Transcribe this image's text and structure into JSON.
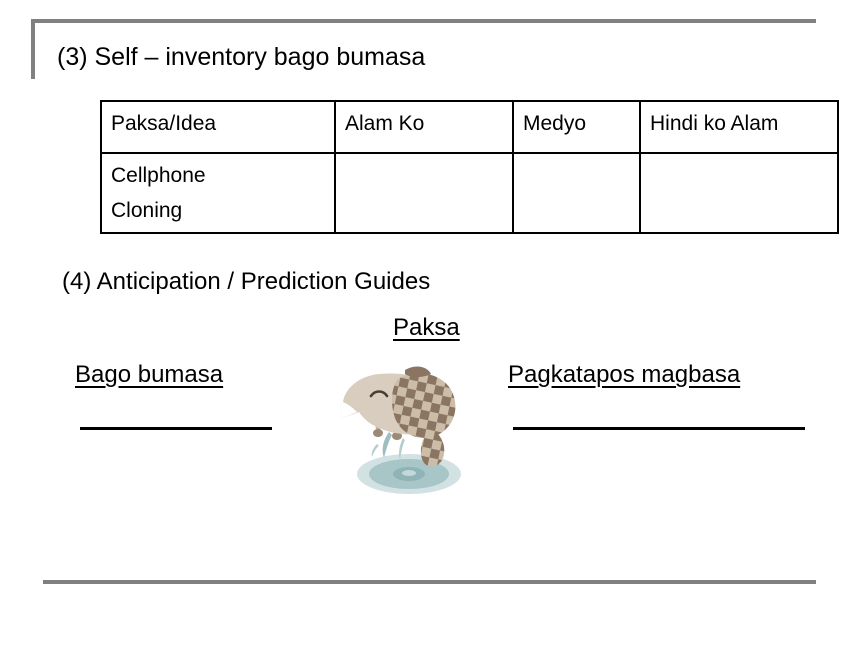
{
  "slide": {
    "section3": {
      "heading": "(3) Self – inventory bago bumasa",
      "table": {
        "headers": [
          "Paksa/Idea",
          "Alam Ko",
          "Medyo",
          "Hindi ko Alam"
        ],
        "rows": [
          {
            "topic_line1": "Cellphone",
            "topic_line2": "Cloning",
            "alam_ko": "",
            "medyo": "",
            "hindi_ko_alam": ""
          }
        ]
      }
    },
    "section4": {
      "heading": "(4) Anticipation / Prediction Guides",
      "topic_label": "Paksa",
      "before_label": "Bago bumasa",
      "after_label": "Pagkatapos magbasa",
      "before_answer": "",
      "after_answer": ""
    },
    "illustration": {
      "name": "lamb-jumping-over-puddle",
      "body_color": "#d9cdbf",
      "patch_light": "#cbbda8",
      "patch_dark": "#8a7562",
      "hoof_color": "#9c8a77",
      "water_color": "#a8c5c8",
      "water_light": "#c3d8d9"
    },
    "frame": {
      "rule_color": "#808080"
    }
  }
}
